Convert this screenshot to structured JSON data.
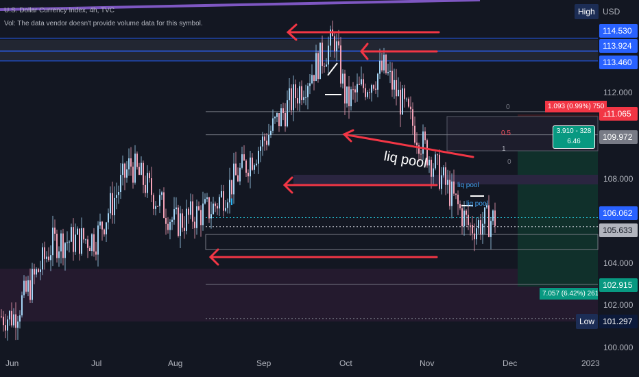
{
  "header": {
    "title": "U.S. Dollar Currency Index, 4h, TVC",
    "vol_note": "Vol: The data vendor doesn't provide volume data for this symbol."
  },
  "currency": "USD",
  "high_label": "High",
  "low_label": "Low",
  "price_axis": {
    "ticks": [
      "112.000",
      "108.000",
      "104.000",
      "102.000",
      "100.000"
    ],
    "tags": [
      {
        "value": "114.530",
        "color": "#2962ff"
      },
      {
        "value": "113.924",
        "color": "#2962ff"
      },
      {
        "value": "113.460",
        "color": "#2962ff"
      },
      {
        "value": "111.065",
        "color": "#f23645"
      },
      {
        "value": "109.972",
        "color": "#787b86"
      },
      {
        "value": "106.062",
        "color": "#2962ff"
      },
      {
        "value": "105.633",
        "color": "#b2b5be"
      },
      {
        "value": "102.915",
        "color": "#089981"
      },
      {
        "value": "101.297",
        "color": "#0c1a3a"
      }
    ]
  },
  "time_axis": [
    "Jun",
    "Jul",
    "Aug",
    "Sep",
    "Oct",
    "Nov",
    "Dec",
    "2023"
  ],
  "annotations": {
    "liq_pool_main": "liq pool",
    "liq_pool_small_1": "liq pool",
    "liq_pool_small_2": "liq pool",
    "risk_label": "1.093 (0.99%) 750",
    "ratio_label_1": "3.910 - 328",
    "ratio_label_2": "6.46",
    "target_label": "7.057 (6.42%) 2614.1",
    "fib_0_top": "0",
    "fib_05": "0.5",
    "fib_1": "1",
    "fib_0_bottom": "0",
    "marker_i": "I"
  },
  "chart_data": {
    "type": "candlestick",
    "symbol": "U.S. Dollar Currency Index",
    "interval": "4h",
    "source": "TVC",
    "x": [
      "Jun",
      "Jul",
      "Aug",
      "Sep",
      "Oct",
      "Nov",
      "Dec"
    ],
    "approx_closes": {
      "Jun": 101.4,
      "mid-Jun": 104.9,
      "Jul": 105.1,
      "mid-Jul": 108.6,
      "Aug": 105.8,
      "mid-Aug": 106.5,
      "Sep": 109.7,
      "late-Sep": 114.5,
      "Oct": 111.5,
      "mid-Oct": 113.1,
      "Nov": 109.3,
      "mid-Nov": 105.6,
      "late-Nov": 106.0
    },
    "horizontal_levels": [
      114.53,
      113.924,
      113.46,
      111.065,
      109.972,
      106.062,
      105.633,
      102.915,
      101.297
    ],
    "ylim": [
      100.0,
      115.6
    ],
    "grid": false
  }
}
